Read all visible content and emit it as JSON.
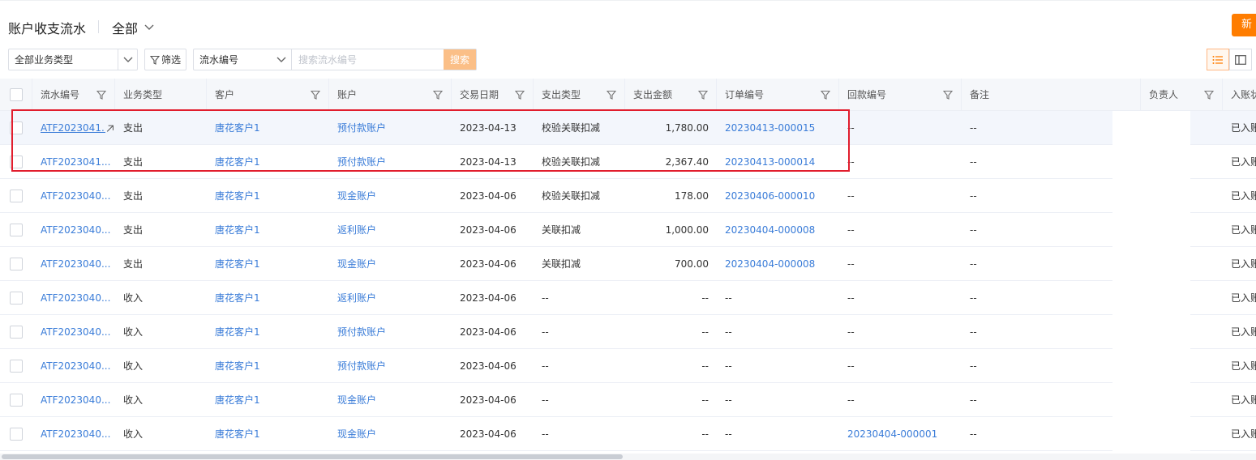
{
  "header": {
    "title": "账户收支流水",
    "view_selector": "全部",
    "new_button": "新"
  },
  "toolbar": {
    "biz_type_select": "全部业务类型",
    "filter_button": "筛选",
    "search_field_select": "流水编号",
    "search_placeholder": "搜索流水编号",
    "search_button": "搜索"
  },
  "table": {
    "columns": [
      "流水编号",
      "业务类型",
      "客户",
      "账户",
      "交易日期",
      "支出类型",
      "支出金额",
      "订单编号",
      "回款编号",
      "备注",
      "负责人",
      "入账状"
    ],
    "rows": [
      {
        "flow_no": "ATF2023041...",
        "biz_type": "支出",
        "customer": "唐花客户1",
        "account": "预付款账户",
        "date": "2023-04-13",
        "expense_type": "校验关联扣减",
        "amount": "1,780.00",
        "order_no": "20230413-000015",
        "payment_no": "--",
        "remark": "--",
        "status": "已入账"
      },
      {
        "flow_no": "ATF2023041...",
        "biz_type": "支出",
        "customer": "唐花客户1",
        "account": "预付款账户",
        "date": "2023-04-13",
        "expense_type": "校验关联扣减",
        "amount": "2,367.40",
        "order_no": "20230413-000014",
        "payment_no": "--",
        "remark": "--",
        "status": "已入账"
      },
      {
        "flow_no": "ATF2023040...",
        "biz_type": "支出",
        "customer": "唐花客户1",
        "account": "现金账户",
        "date": "2023-04-06",
        "expense_type": "校验关联扣减",
        "amount": "178.00",
        "order_no": "20230406-000010",
        "payment_no": "--",
        "remark": "--",
        "status": "已入账"
      },
      {
        "flow_no": "ATF2023040...",
        "biz_type": "支出",
        "customer": "唐花客户1",
        "account": "返利账户",
        "date": "2023-04-06",
        "expense_type": "关联扣减",
        "amount": "1,000.00",
        "order_no": "20230404-000008",
        "payment_no": "--",
        "remark": "--",
        "status": "已入账"
      },
      {
        "flow_no": "ATF2023040...",
        "biz_type": "支出",
        "customer": "唐花客户1",
        "account": "现金账户",
        "date": "2023-04-06",
        "expense_type": "关联扣减",
        "amount": "700.00",
        "order_no": "20230404-000008",
        "payment_no": "--",
        "remark": "--",
        "status": "已入账"
      },
      {
        "flow_no": "ATF2023040...",
        "biz_type": "收入",
        "customer": "唐花客户1",
        "account": "返利账户",
        "date": "2023-04-06",
        "expense_type": "--",
        "amount": "--",
        "order_no": "--",
        "payment_no": "--",
        "remark": "--",
        "status": "已入账"
      },
      {
        "flow_no": "ATF2023040...",
        "biz_type": "收入",
        "customer": "唐花客户1",
        "account": "预付款账户",
        "date": "2023-04-06",
        "expense_type": "--",
        "amount": "--",
        "order_no": "--",
        "payment_no": "--",
        "remark": "--",
        "status": "已入账"
      },
      {
        "flow_no": "ATF2023040...",
        "biz_type": "收入",
        "customer": "唐花客户1",
        "account": "预付款账户",
        "date": "2023-04-06",
        "expense_type": "--",
        "amount": "--",
        "order_no": "--",
        "payment_no": "--",
        "remark": "--",
        "status": "已入账"
      },
      {
        "flow_no": "ATF2023040...",
        "biz_type": "收入",
        "customer": "唐花客户1",
        "account": "现金账户",
        "date": "2023-04-06",
        "expense_type": "--",
        "amount": "--",
        "order_no": "--",
        "payment_no": "--",
        "remark": "--",
        "status": "已入账"
      },
      {
        "flow_no": "ATF2023040...",
        "biz_type": "收入",
        "customer": "唐花客户1",
        "account": "现金账户",
        "date": "2023-04-06",
        "expense_type": "--",
        "amount": "--",
        "order_no": "--",
        "payment_no": "20230404-000001",
        "remark": "--",
        "status": "已入账"
      }
    ]
  },
  "colors": {
    "accent": "#ff7d00",
    "search_button": "#fbbf87",
    "link": "#3a7cd8",
    "highlight_box": "#e11d2d"
  },
  "icons": [
    "chevron-down-icon",
    "filter-icon",
    "list-view-icon",
    "card-view-icon",
    "open-link-icon"
  ]
}
